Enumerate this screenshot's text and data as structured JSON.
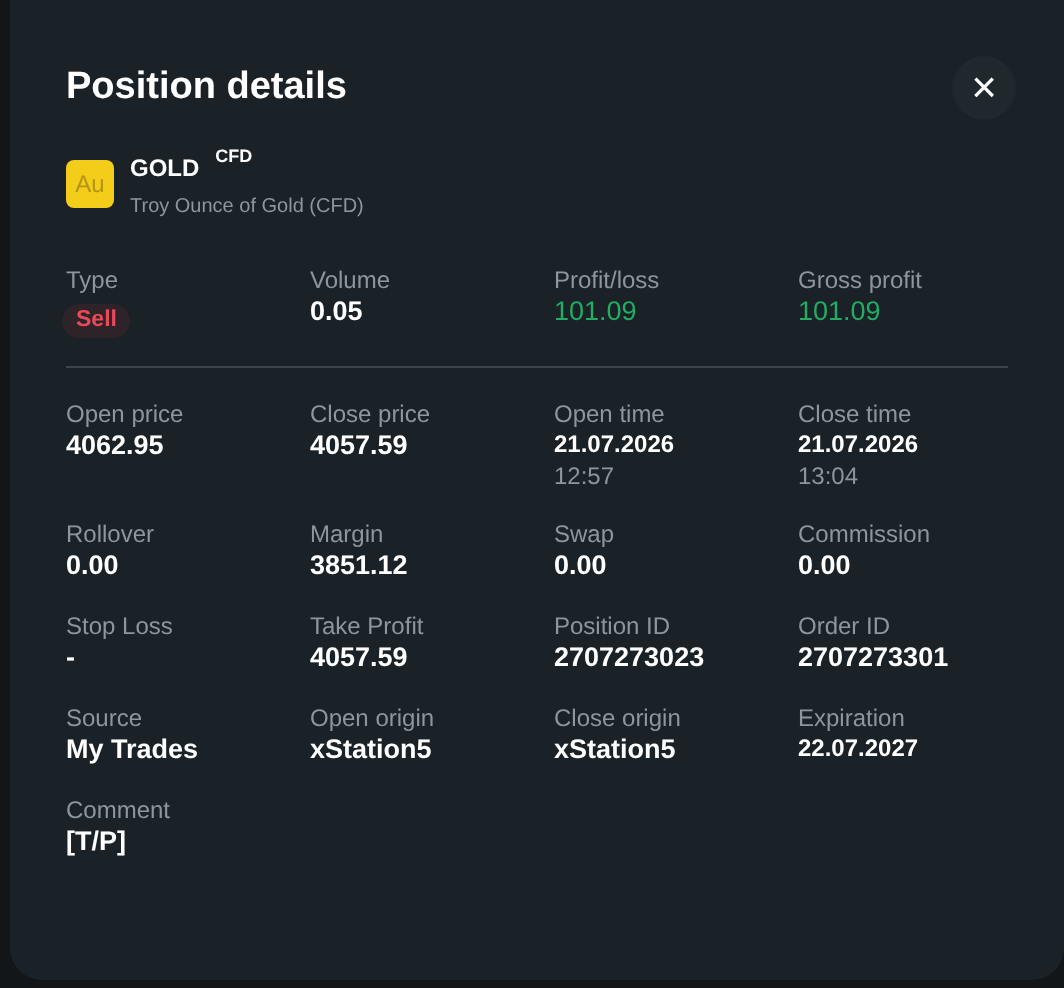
{
  "title": "Position details",
  "close_button": {
    "label": "×"
  },
  "instrument": {
    "logo": "Au",
    "symbol": "GOLD",
    "tag": "CFD",
    "description": "Troy Ounce of Gold (CFD)"
  },
  "summary": [
    {
      "label": "Type",
      "value": "Sell",
      "kind": "sell"
    },
    {
      "label": "Volume",
      "value": "0.05",
      "kind": "plain"
    },
    {
      "label": "Profit/loss",
      "value": "101.09",
      "kind": "gain"
    },
    {
      "label": "Gross profit",
      "value": "101.09",
      "kind": "gain"
    }
  ],
  "details": [
    {
      "label": "Open price",
      "value": "4062.95",
      "kind": "plain"
    },
    {
      "label": "Close price",
      "value": "4057.59",
      "kind": "plain"
    },
    {
      "label": "Open time",
      "value": "21.07.2026",
      "time": "12:57",
      "kind": "date"
    },
    {
      "label": "Close time",
      "value": "21.07.2026",
      "time": "13:04",
      "kind": "date"
    },
    {
      "label": "Rollover",
      "value": "0.00",
      "kind": "plain"
    },
    {
      "label": "Margin",
      "value": "3851.12",
      "kind": "plain"
    },
    {
      "label": "Swap",
      "value": "0.00",
      "kind": "plain"
    },
    {
      "label": "Commission",
      "value": "0.00",
      "kind": "plain"
    },
    {
      "label": "Stop Loss",
      "value": "-",
      "kind": "plain"
    },
    {
      "label": "Take Profit",
      "value": "4057.59",
      "kind": "plain"
    },
    {
      "label": "Position ID",
      "value": "2707273023",
      "kind": "plain"
    },
    {
      "label": "Order ID",
      "value": "2707273301",
      "kind": "plain"
    },
    {
      "label": "Source",
      "value": "My Trades",
      "kind": "plain"
    },
    {
      "label": "Open origin",
      "value": "xStation5",
      "kind": "plain"
    },
    {
      "label": "Close origin",
      "value": "xStation5",
      "kind": "plain"
    },
    {
      "label": "Expiration",
      "value": "22.07.2027",
      "kind": "date"
    },
    {
      "label": "Comment",
      "value": "[T/P]",
      "kind": "plain"
    }
  ]
}
